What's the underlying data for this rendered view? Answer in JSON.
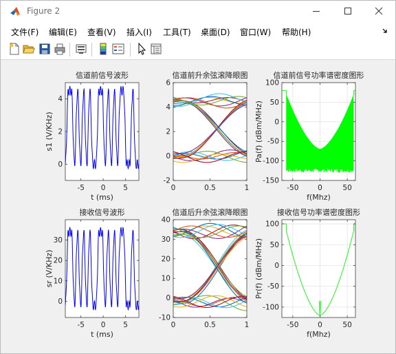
{
  "window": {
    "title": "Figure 2"
  },
  "menu": [
    {
      "label": "文件(F)"
    },
    {
      "label": "编辑(E)"
    },
    {
      "label": "查看(V)"
    },
    {
      "label": "插入(I)"
    },
    {
      "label": "工具(T)"
    },
    {
      "label": "桌面(D)"
    },
    {
      "label": "窗口(W)"
    },
    {
      "label": "帮助(H)"
    }
  ],
  "toolbar": [
    {
      "icon": "new-figure-icon"
    },
    {
      "icon": "open-file-icon"
    },
    {
      "icon": "save-icon"
    },
    {
      "icon": "print-icon"
    },
    {
      "icon": "link-plot-icon"
    },
    {
      "icon": "colorbar-icon"
    },
    {
      "icon": "legend-icon"
    },
    {
      "icon": "pointer-icon"
    },
    {
      "icon": "property-inspector-icon"
    }
  ],
  "chart_data": [
    {
      "type": "line",
      "title": "信道前信号波形",
      "xlabel": "t (ms)",
      "ylabel": "s1   (V/KHz)",
      "xlim": [
        -8.5,
        8
      ],
      "ylim": [
        -1,
        5
      ],
      "xticks": [
        "-5",
        "0",
        "5"
      ],
      "yticks": [
        "0",
        "2",
        "4"
      ],
      "series": [
        {
          "color": "#0000ff",
          "levels": [
            0,
            1,
            1,
            0,
            1,
            0,
            1,
            0,
            1,
            0,
            0,
            1,
            1,
            0,
            1,
            0,
            1,
            0,
            1,
            1,
            0,
            0,
            1,
            0
          ],
          "high": 4.5,
          "low": 0,
          "x_range": [
            -8.5,
            8
          ]
        }
      ]
    },
    {
      "type": "line",
      "title": "信道前升余弦滚降眼图",
      "xlabel": "",
      "ylabel": "",
      "xlim": [
        0,
        1
      ],
      "ylim": [
        -2,
        6
      ],
      "xticks": [
        "0",
        "0.5",
        "1"
      ],
      "yticks": [
        "-2",
        "0",
        "2",
        "4",
        "6"
      ],
      "series": [
        {
          "name": "",
          "eye_high": 4.5,
          "eye_low": 0,
          "crossing": 0.6
        }
      ]
    },
    {
      "type": "line",
      "title": "信道前信号功率谱密度图形",
      "xlabel": "f(Mhz)",
      "ylabel": "Pa(f) (dBm/MHz)",
      "xlim": [
        -70,
        65
      ],
      "ylim": [
        -150,
        100
      ],
      "xticks": [
        "-50",
        "0",
        "50"
      ],
      "yticks": [
        "-150",
        "-100",
        "-50",
        "0",
        "50",
        "100"
      ],
      "series": [
        {
          "color": "#00ff00",
          "center_level": -70,
          "edge_level": 80,
          "spike_floor": -130
        }
      ]
    },
    {
      "type": "line",
      "title": "接收信号波形",
      "xlabel": "t (ms)",
      "ylabel": "sr   (V/KHz)",
      "xlim": [
        -8.5,
        8
      ],
      "ylim": [
        -8,
        40
      ],
      "xticks": [
        "-5",
        "0",
        "5"
      ],
      "yticks": [
        "0",
        "10",
        "20",
        "30"
      ],
      "series": [
        {
          "color": "#0000ff",
          "levels": [
            0,
            1,
            1,
            0,
            1,
            0,
            1,
            0,
            1,
            0,
            0,
            1,
            1,
            0,
            1,
            0,
            1,
            0,
            1,
            1,
            0,
            0,
            1,
            0
          ],
          "high": 34,
          "low": -2,
          "x_range": [
            -8.5,
            8
          ]
        }
      ]
    },
    {
      "type": "line",
      "title": "信道后升余弦滚降眼图",
      "xlabel": "",
      "ylabel": "",
      "xlim": [
        0,
        1
      ],
      "ylim": [
        -10,
        40
      ],
      "xticks": [
        "0",
        "0.5",
        "1"
      ],
      "yticks": [
        "-10",
        "0",
        "10",
        "20",
        "30",
        "40"
      ],
      "series": [
        {
          "name": "",
          "eye_high": 34,
          "eye_low": -2,
          "crossing": 0.6
        }
      ]
    },
    {
      "type": "line",
      "title": "接收信号功率谱密度图形",
      "xlabel": "f(Mhz)",
      "ylabel": "Pr(f) (dBm/MHz)",
      "xlim": [
        -70,
        65
      ],
      "ylim": [
        -125,
        110
      ],
      "xticks": [
        "-50",
        "0",
        "50"
      ],
      "yticks": [
        "-100",
        "-50",
        "0",
        "50",
        "100"
      ],
      "series": [
        {
          "color": "#00ff00",
          "center_level": -120,
          "edge_level": 100
        }
      ]
    }
  ],
  "eye_colors": [
    "#0072bd",
    "#d95319",
    "#edb120",
    "#7e2f8e",
    "#77ac30",
    "#4dbeee",
    "#a2142f"
  ]
}
